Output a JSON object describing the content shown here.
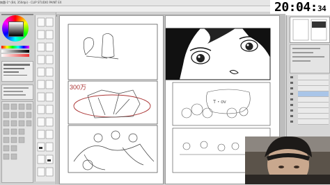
{
  "window": {
    "title": "無題-1* (B4, 350dpi) - CLIP STUDIO PAINT EX"
  },
  "stream_clock": {
    "time_main": "20:04:",
    "time_seconds": "34"
  },
  "canvas": {
    "sketch_labels": {
      "count_label": "300万",
      "speech_text": "T・ov"
    }
  },
  "icons": {
    "color_wheel": "color-wheel-icon",
    "tools": "tool-palette-icons"
  },
  "colors": {
    "accent": "#a9c5e8",
    "canvas": "#ffffff",
    "ui_gray": "#d8d8d8"
  }
}
